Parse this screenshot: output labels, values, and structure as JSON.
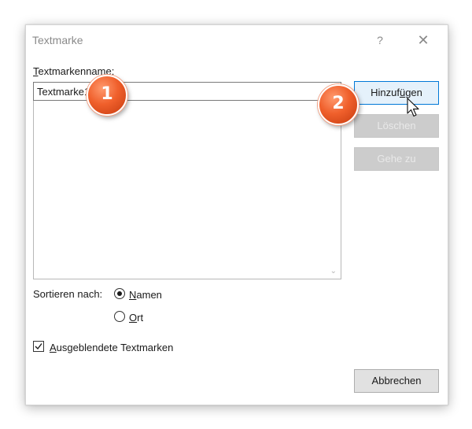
{
  "dialog": {
    "title": "Textmarke",
    "help_label": "?",
    "close_label": "✕"
  },
  "name_field": {
    "label_accel": "T",
    "label_rest": "extmarkenname:",
    "value": "Textmarke1"
  },
  "list": {
    "scroll_arrow": "⌄"
  },
  "buttons": {
    "add_pre": "Hinzuf",
    "add_accel": "ü",
    "add_post": "gen",
    "delete_label": "Löschen",
    "goto_label": "Gehe zu",
    "cancel_label": "Abbrechen"
  },
  "sort": {
    "label": "Sortieren nach:",
    "options": [
      {
        "accel": "N",
        "rest": "amen",
        "checked": true
      },
      {
        "accel": "O",
        "rest": "rt",
        "checked": false
      }
    ]
  },
  "hidden_bookmarks": {
    "accel": "A",
    "rest": "usgeblendete Textmarken",
    "checked": true
  },
  "badges": [
    "1",
    "2"
  ],
  "colors": {
    "accent": "#0078d7",
    "badge": "#f0602c",
    "disabled_button": "#cccccc"
  }
}
